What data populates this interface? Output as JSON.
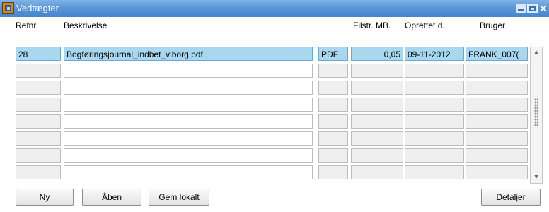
{
  "window": {
    "title": "Vedtægter"
  },
  "columns": {
    "refnr": "Refnr.",
    "beskrivelse": "Beskrivelse",
    "filstr": "Filstr. MB.",
    "oprettet": "Oprettet d.",
    "bruger": "Bruger"
  },
  "rows": [
    {
      "refnr": "28",
      "beskrivelse": "Bogføringsjournal_indbet_viborg.pdf",
      "type": "PDF",
      "filstr": "0,05",
      "oprettet": "09-11-2012",
      "bruger": "FRANK_007("
    },
    {
      "refnr": "",
      "beskrivelse": "",
      "type": "",
      "filstr": "",
      "oprettet": "",
      "bruger": ""
    },
    {
      "refnr": "",
      "beskrivelse": "",
      "type": "",
      "filstr": "",
      "oprettet": "",
      "bruger": ""
    },
    {
      "refnr": "",
      "beskrivelse": "",
      "type": "",
      "filstr": "",
      "oprettet": "",
      "bruger": ""
    },
    {
      "refnr": "",
      "beskrivelse": "",
      "type": "",
      "filstr": "",
      "oprettet": "",
      "bruger": ""
    },
    {
      "refnr": "",
      "beskrivelse": "",
      "type": "",
      "filstr": "",
      "oprettet": "",
      "bruger": ""
    },
    {
      "refnr": "",
      "beskrivelse": "",
      "type": "",
      "filstr": "",
      "oprettet": "",
      "bruger": ""
    },
    {
      "refnr": "",
      "beskrivelse": "",
      "type": "",
      "filstr": "",
      "oprettet": "",
      "bruger": ""
    }
  ],
  "buttons": {
    "ny": {
      "pre": "",
      "ul": "N",
      "post": "y"
    },
    "aaben": {
      "pre": "",
      "ul": "Å",
      "post": "ben"
    },
    "gem": {
      "pre": "Ge",
      "ul": "m",
      "post": " lokalt"
    },
    "detaljer": {
      "pre": "",
      "ul": "D",
      "post": "etaljer"
    }
  },
  "icons": {
    "app": "app-icon",
    "minimize": "minimize-icon",
    "maximize": "maximize-icon",
    "close": "close-icon",
    "scroll_up": "scroll-up-arrow-icon",
    "scroll_down": "scroll-down-arrow-icon"
  },
  "colors": {
    "titlebar": "#5b97d8",
    "selected_row": "#a8d8f0",
    "field_gray": "#efefef"
  }
}
